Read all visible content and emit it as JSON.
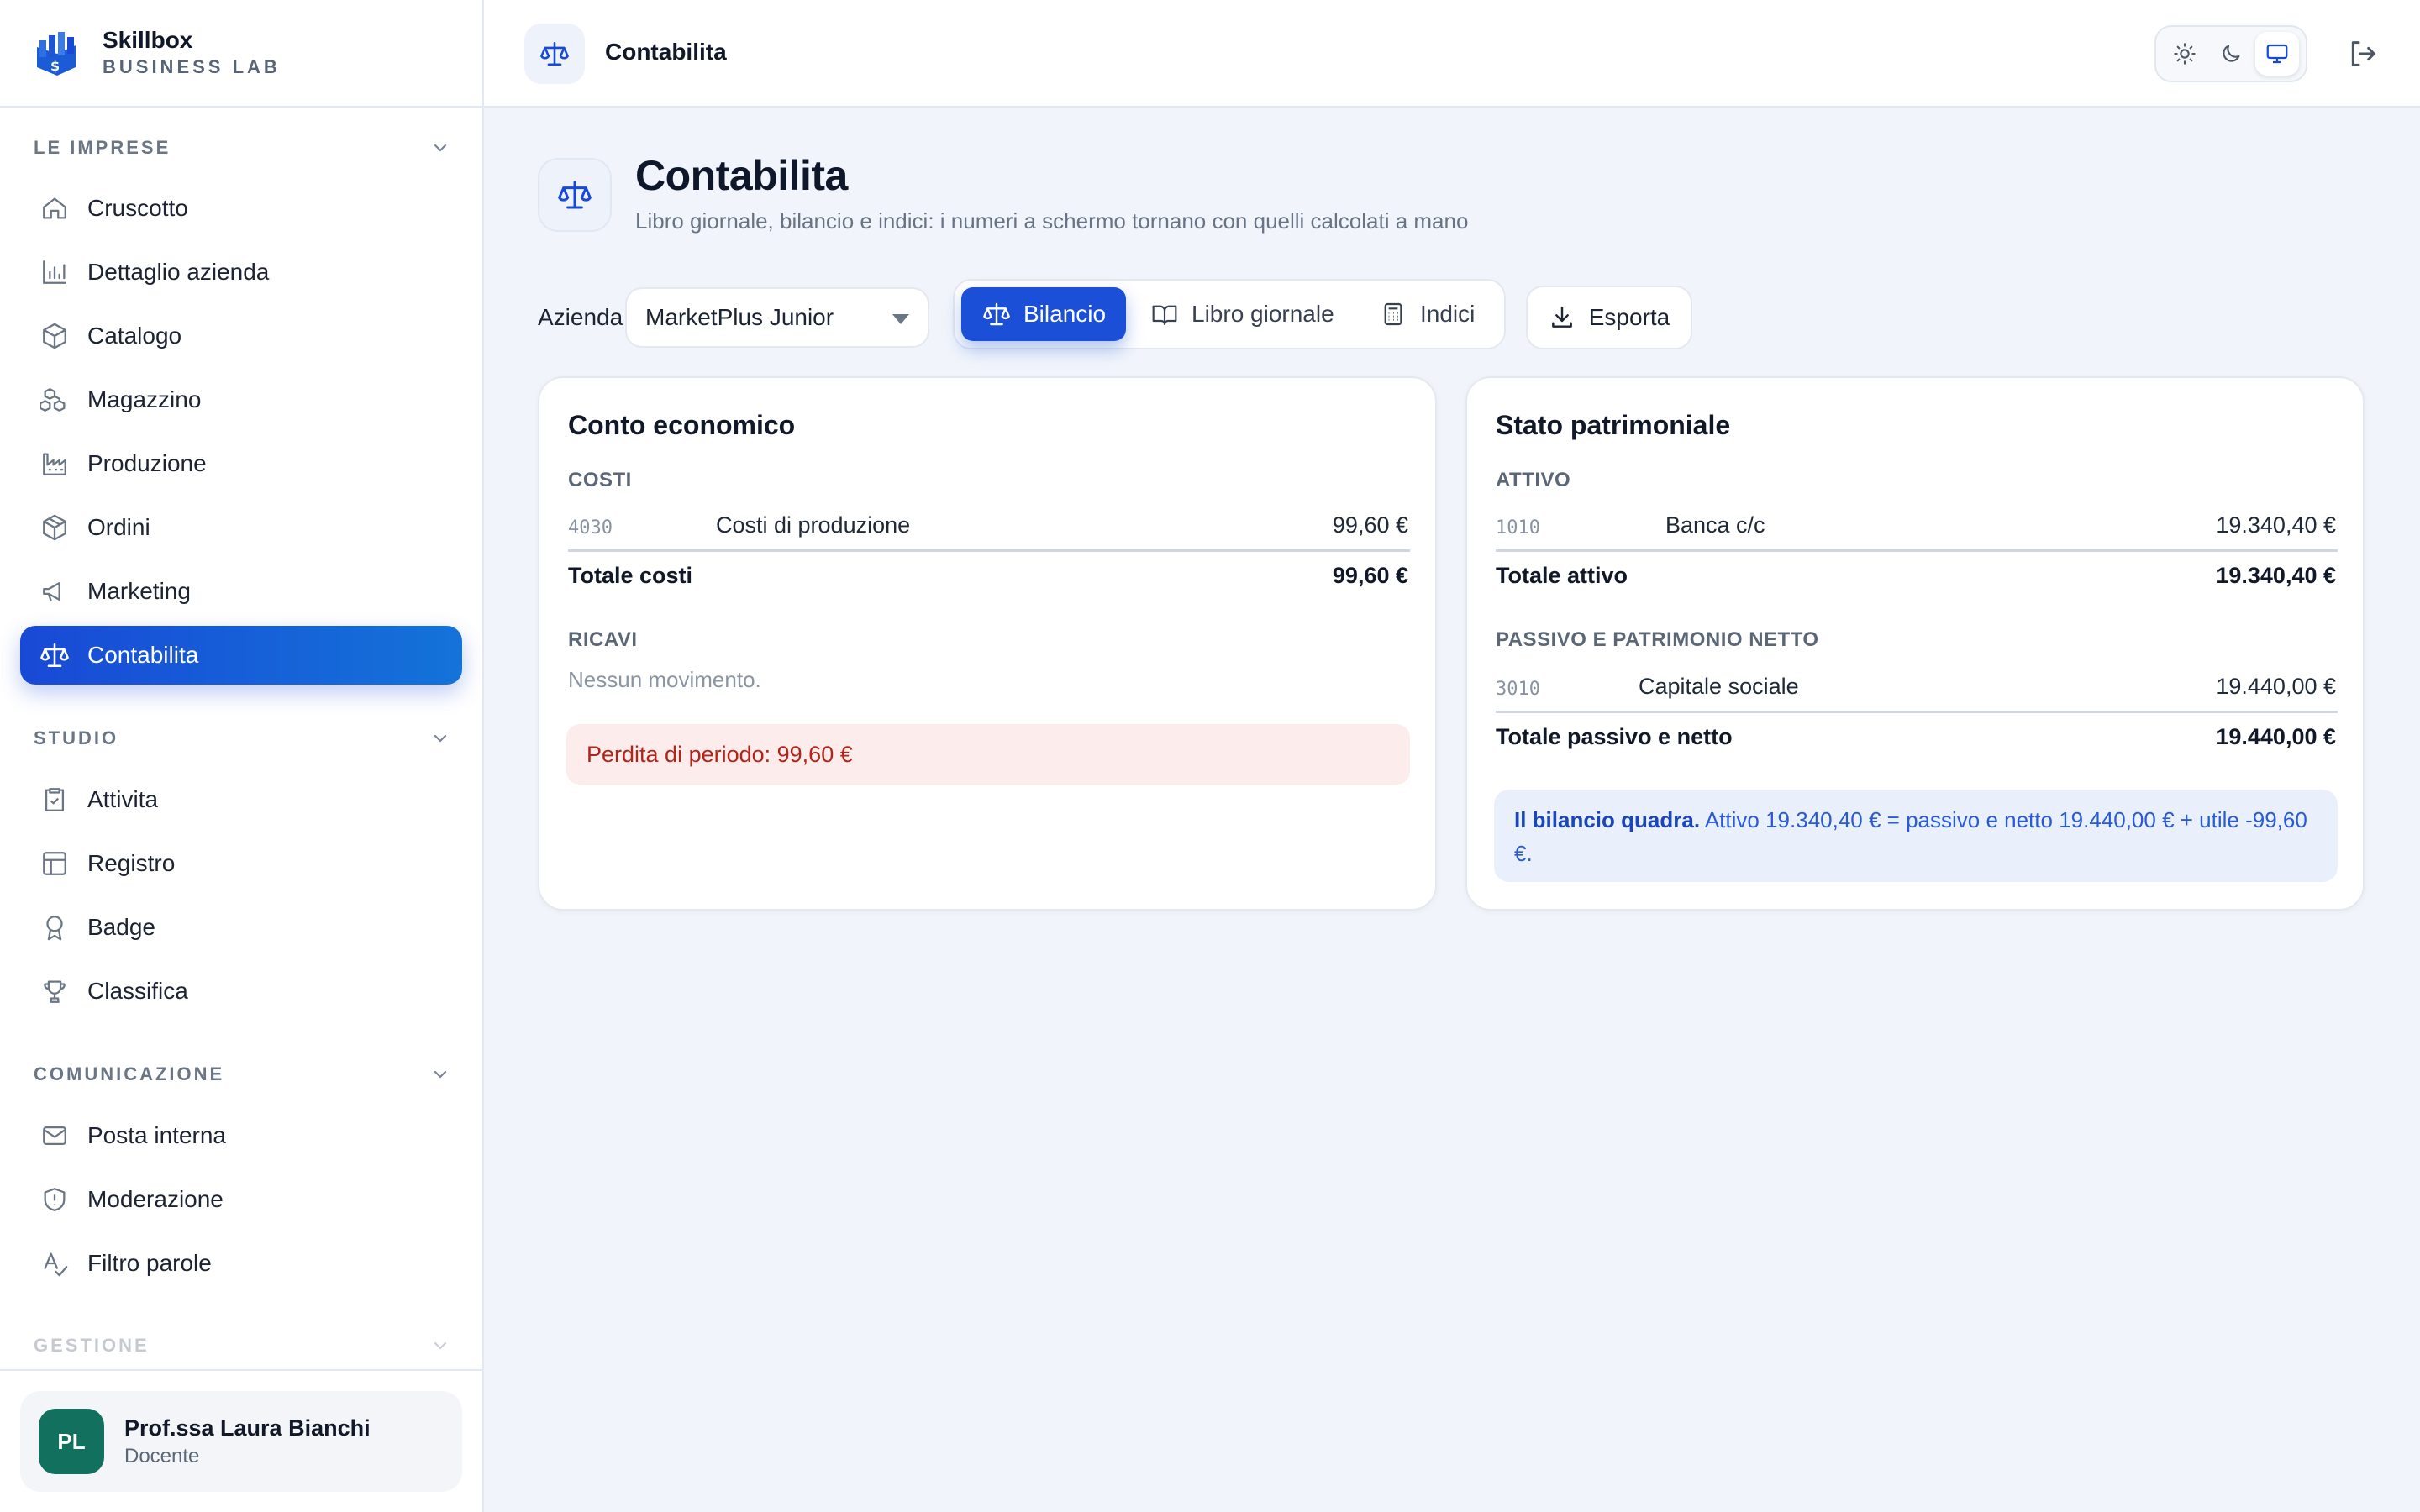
{
  "brand": {
    "name": "Skillbox",
    "subtitle": "BUSINESS LAB"
  },
  "sidebar": {
    "sections": [
      {
        "title": "LE IMPRESE",
        "items": [
          {
            "label": "Cruscotto",
            "icon": "home-icon"
          },
          {
            "label": "Dettaglio azienda",
            "icon": "bar-chart-icon"
          },
          {
            "label": "Catalogo",
            "icon": "package-icon"
          },
          {
            "label": "Magazzino",
            "icon": "boxes-icon"
          },
          {
            "label": "Produzione",
            "icon": "factory-icon"
          },
          {
            "label": "Ordini",
            "icon": "package-icon"
          },
          {
            "label": "Marketing",
            "icon": "megaphone-icon"
          },
          {
            "label": "Contabilita",
            "icon": "scale-icon",
            "active": true
          }
        ]
      },
      {
        "title": "STUDIO",
        "items": [
          {
            "label": "Attivita",
            "icon": "clipboard-check-icon"
          },
          {
            "label": "Registro",
            "icon": "table-icon"
          },
          {
            "label": "Badge",
            "icon": "award-icon"
          },
          {
            "label": "Classifica",
            "icon": "trophy-icon"
          }
        ]
      },
      {
        "title": "COMUNICAZIONE",
        "items": [
          {
            "label": "Posta interna",
            "icon": "mail-icon"
          },
          {
            "label": "Moderazione",
            "icon": "shield-icon"
          },
          {
            "label": "Filtro parole",
            "icon": "spell-check-icon"
          }
        ]
      },
      {
        "title": "GESTIONE",
        "items": []
      }
    ],
    "user": {
      "initials": "PL",
      "name": "Prof.ssa Laura Bianchi",
      "role": "Docente"
    }
  },
  "topbar": {
    "title": "Contabilita",
    "theme_options": [
      "light",
      "dark",
      "system"
    ],
    "theme_selected": "system"
  },
  "page": {
    "title": "Contabilita",
    "subtitle": "Libro giornale, bilancio e indici: i numeri a schermo tornano con quelli calcolati a mano"
  },
  "toolbar": {
    "company_label": "Azienda",
    "company_selected": "MarketPlus Junior",
    "tabs": [
      {
        "label": "Bilancio",
        "icon": "scale-icon",
        "active": true
      },
      {
        "label": "Libro giornale",
        "icon": "book-open-icon"
      },
      {
        "label": "Indici",
        "icon": "calculator-icon"
      }
    ],
    "export_label": "Esporta"
  },
  "conto_economico": {
    "title": "Conto economico",
    "costs_label": "COSTI",
    "costs": [
      {
        "code": "4030",
        "name": "Costi di produzione",
        "amount": "99,60 €"
      }
    ],
    "costs_total_label": "Totale costi",
    "costs_total": "99,60 €",
    "revenues_label": "RICAVI",
    "revenues_empty": "Nessun movimento.",
    "result": "Perdita di periodo: 99,60 €"
  },
  "stato_patrimoniale": {
    "title": "Stato patrimoniale",
    "assets_label": "ATTIVO",
    "assets": [
      {
        "code": "1010",
        "name": "Banca c/c",
        "amount": "19.340,40 €"
      }
    ],
    "assets_total_label": "Totale attivo",
    "assets_total": "19.340,40 €",
    "liabilities_label": "PASSIVO E PATRIMONIO NETTO",
    "liabilities": [
      {
        "code": "3010",
        "name": "Capitale sociale",
        "amount": "19.440,00 €"
      }
    ],
    "liabilities_total_label": "Totale passivo e netto",
    "liabilities_total": "19.440,00 €",
    "check_strong": "Il bilancio quadra.",
    "check_text": "Attivo 19.340,40 € = passivo e netto 19.440,00 € + utile -99,60 €."
  },
  "colors": {
    "accent": "#1849d6",
    "loss_bg": "#fdecec",
    "loss_text": "#b42318",
    "avatar": "#12705e"
  }
}
